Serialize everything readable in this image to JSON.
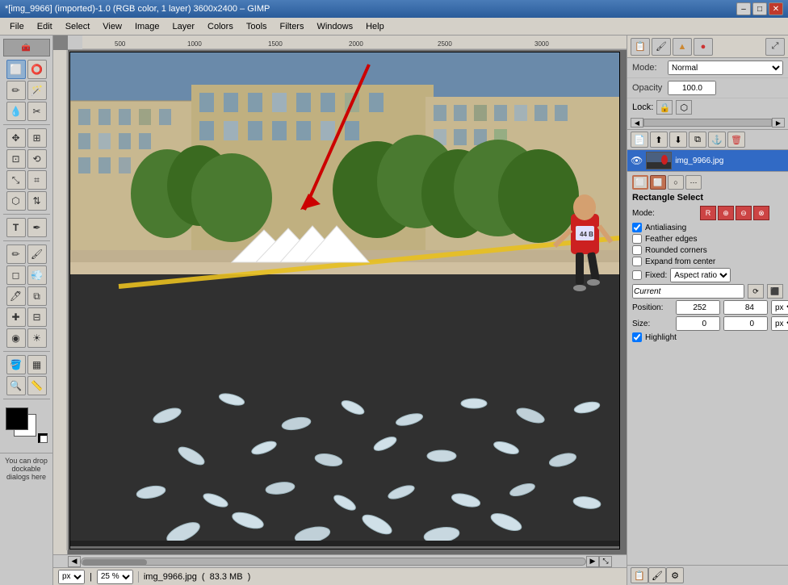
{
  "titlebar": {
    "title": "*[img_9966] (imported)-1.0 (RGB color, 1 layer) 3600x2400 – GIMP",
    "minimize": "–",
    "maximize": "□",
    "close": "✕"
  },
  "menubar": {
    "items": [
      "File",
      "Edit",
      "Select",
      "View",
      "Image",
      "Layer",
      "Colors",
      "Tools",
      "Filters",
      "Windows",
      "Help"
    ]
  },
  "tools": {
    "rows": [
      [
        "✛",
        "⊹"
      ],
      [
        "↖",
        "✂"
      ],
      [
        "↔",
        "⟲"
      ],
      [
        "✏",
        "🪣"
      ],
      [
        "🔍",
        "✥"
      ],
      [
        "⬛",
        "◈"
      ],
      [
        "🖊",
        "🔧"
      ],
      [
        "✒",
        "🪣"
      ],
      [
        "💧",
        "🎨"
      ],
      [
        "🔤",
        "🪄"
      ],
      [
        "⬛",
        "⬜"
      ],
      [
        "⤡",
        "📐"
      ]
    ]
  },
  "canvas": {
    "zoom": "25 %",
    "filename": "img_9966.jpg",
    "filesize": "83.3 MB",
    "zoom_unit": "px"
  },
  "right_panel": {
    "mode_label": "Mode:",
    "mode_value": "Normal",
    "opacity_label": "Opacity",
    "opacity_value": "100.0",
    "lock_label": "Lock:",
    "layer_name": "img_9966.jpg",
    "scrollbar_section": true
  },
  "tool_options": {
    "title": "Rectangle Select",
    "mode_label": "Mode:",
    "modes": [
      "R",
      "⊕",
      "⊖",
      "⊗"
    ],
    "antialiasing_label": "Antialiasing",
    "antialiasing_checked": true,
    "feather_label": "Feather edges",
    "feather_checked": false,
    "rounded_label": "Rounded corners",
    "rounded_checked": false,
    "expand_label": "Expand from center",
    "expand_checked": false,
    "fixed_label": "Fixed:",
    "fixed_checked": false,
    "fixed_value": "Aspect ratio",
    "current_label": "Current",
    "position_label": "Position:",
    "pos_x": "252",
    "pos_y": "84",
    "pos_unit": "px",
    "size_label": "Size:",
    "size_w": "0",
    "size_h": "0",
    "size_unit": "px",
    "highlight_label": "Highlight",
    "highlight_checked": true
  },
  "bottom_panel": {
    "dock_text": "You can drop dockable dialogs here"
  }
}
